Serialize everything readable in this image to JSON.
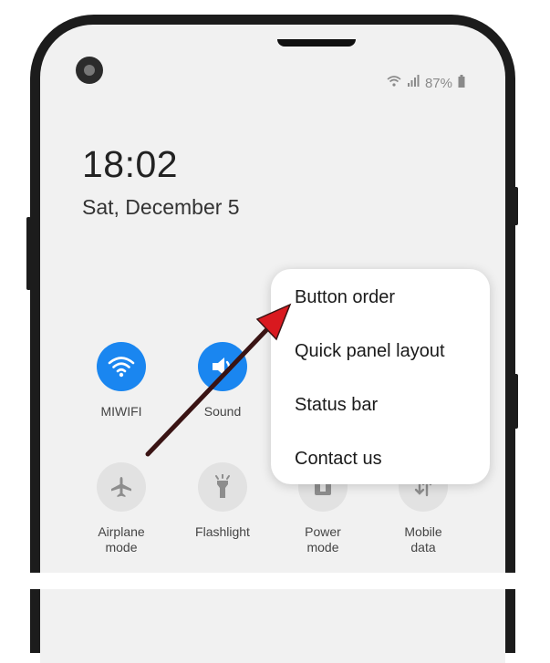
{
  "status_bar": {
    "battery": "87%"
  },
  "lockscreen": {
    "time": "18:02",
    "date": "Sat, December 5"
  },
  "quick_tiles": [
    {
      "label": "MIWIFI",
      "icon": "wifi-icon",
      "state": "on"
    },
    {
      "label": "Sound",
      "icon": "sound-icon",
      "state": "on"
    },
    {
      "label": "Airplane\nmode",
      "icon": "airplane-icon",
      "state": "off"
    },
    {
      "label": "Flashlight",
      "icon": "flashlight-icon",
      "state": "off"
    },
    {
      "label": "Power\nmode",
      "icon": "power-mode-icon",
      "state": "off"
    },
    {
      "label": "Mobile\ndata",
      "icon": "mobile-data-icon",
      "state": "off"
    }
  ],
  "menu": {
    "items": [
      "Button order",
      "Quick panel layout",
      "Status bar",
      "Contact us"
    ]
  },
  "colors": {
    "accent": "#1a86f0",
    "arrow": "#3a1414",
    "arrow_head": "#d9191f"
  }
}
